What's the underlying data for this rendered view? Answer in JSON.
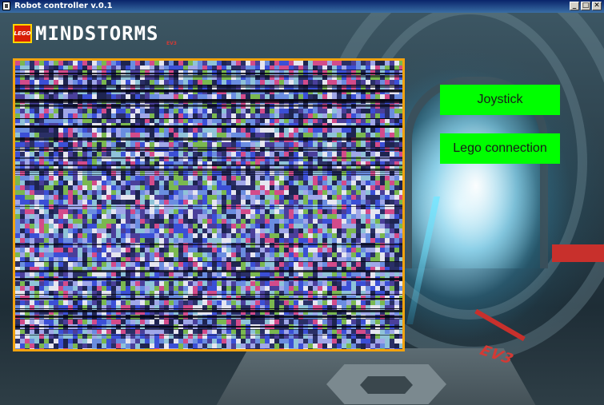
{
  "window": {
    "title": "Robot controller v.0.1",
    "controls": {
      "minimize": "_",
      "maximize": "□",
      "close": "✕"
    }
  },
  "logo": {
    "badge_text": "LEGO",
    "wordmark": "MINDSTORMS",
    "sub_mark": "EV3"
  },
  "background": {
    "floor_mark": "EV3"
  },
  "video_feed": {
    "state": "static-noise",
    "border_color": "#f2a30f"
  },
  "buttons": {
    "joystick_label": "Joystick",
    "lego_connection_label": "Lego connection",
    "color": "#00ff00"
  },
  "icons": {
    "app_icon": "window-app-icon",
    "minimize": "minimize-icon",
    "maximize": "maximize-icon",
    "close": "close-icon"
  }
}
